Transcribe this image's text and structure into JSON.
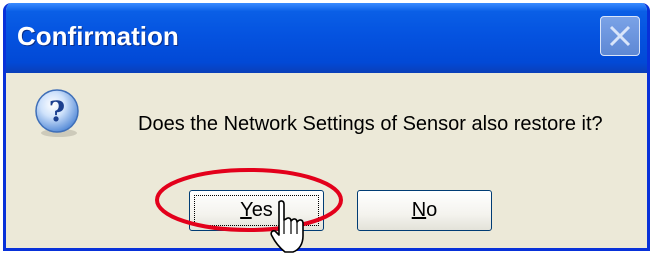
{
  "dialog": {
    "title": "Confirmation",
    "message": "Does the Network Settings of Sensor also restore it?",
    "icon": "question-icon",
    "buttons": {
      "yes_prefix": "",
      "yes_mnemonic": "Y",
      "yes_rest": "es",
      "no_prefix": "",
      "no_mnemonic": "N",
      "no_rest": "o"
    },
    "close_icon": "close-icon"
  },
  "colors": {
    "titlebar": "#0553e0",
    "dialog_bg": "#ece9d8",
    "highlight": "#e3001b"
  }
}
